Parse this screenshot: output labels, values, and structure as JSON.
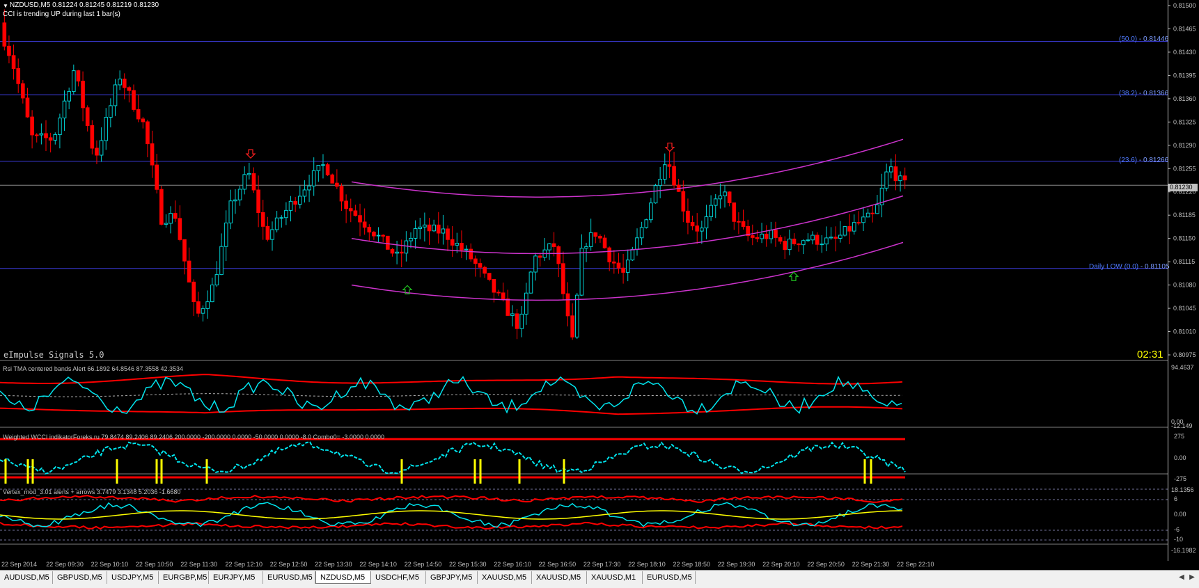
{
  "window": {
    "symbol_header": "NZDUSD,M5  0.81224 0.81245 0.81219 0.81230",
    "trend_message": "CCI is trending UP during last 1 bar(s)",
    "brand": "eImpulse Signals 5.0",
    "timer": "02:31",
    "current_price": "0.81230"
  },
  "price_axis": {
    "labels": [
      "0.81500",
      "0.81465",
      "0.81430",
      "0.81395",
      "0.81360",
      "0.81325",
      "0.81290",
      "0.81255",
      "0.81220",
      "0.81185",
      "0.81150",
      "0.81115",
      "0.81080",
      "0.81045",
      "0.81010",
      "0.80975"
    ],
    "min": 0.80975,
    "max": 0.815
  },
  "fib_levels": [
    {
      "paren": "(50.0)",
      "label": "- 0.81446",
      "value": 0.81446
    },
    {
      "paren": "(38.2)",
      "label": "- 0.81366",
      "value": 0.81366
    },
    {
      "paren": "(23.6)",
      "label": "- 0.81266",
      "value": 0.81266
    },
    {
      "paren": "Daily LOW",
      "paren2": "(0.0)",
      "label": "- 0.81105",
      "value": 0.81105
    }
  ],
  "indicators": {
    "rsi": {
      "title": "Rsi TMA centered bands Alert 66.1892 64.8546 87.3558 42.3534",
      "axis_top": "94.4637",
      "axis_mid": "0.00",
      "axis_bot": "-12.149"
    },
    "wcci": {
      "title": "Weighted WCCI indikatorForeks.ru 79.8474 89.2406 89.2406 200.0000 -200.0000 0.0000 -50.0000 0.0000 -8.0 Combo0= -3.0000 0.0000",
      "axis": [
        "275",
        "0.00",
        "-275"
      ]
    },
    "vertex": {
      "title": "Vertex_mod_3.01 alerts + arrows 3.7479 3.1348 5.2036 -1.6680",
      "axis": [
        "18.1356",
        "6",
        "0.00",
        "-6",
        "-10",
        "-16.1982"
      ]
    }
  },
  "time_axis": [
    "22 Sep 2014",
    "22 Sep 09:30",
    "22 Sep 10:10",
    "22 Sep 10:50",
    "22 Sep 11:30",
    "22 Sep 12:10",
    "22 Sep 12:50",
    "22 Sep 13:30",
    "22 Sep 14:10",
    "22 Sep 14:50",
    "22 Sep 15:30",
    "22 Sep 16:10",
    "22 Sep 16:50",
    "22 Sep 17:30",
    "22 Sep 18:10",
    "22 Sep 18:50",
    "22 Sep 19:30",
    "22 Sep 20:10",
    "22 Sep 20:50",
    "22 Sep 21:30",
    "22 Sep 22:10"
  ],
  "tabs": [
    {
      "label": "AUDUSD,M5",
      "active": false
    },
    {
      "label": "GBPUSD,M5",
      "active": false
    },
    {
      "label": "USDJPY,M5",
      "active": false
    },
    {
      "label": "EURGBP,M5",
      "active": false
    },
    {
      "label": "EURJPY,M5",
      "active": false
    },
    {
      "label": "EURUSD,M5",
      "active": false
    },
    {
      "label": "NZDUSD,M5",
      "active": true
    },
    {
      "label": "USDCHF,M5",
      "active": false
    },
    {
      "label": "GBPJPY,M5",
      "active": false
    },
    {
      "label": "XAUUSD,M5",
      "active": false
    },
    {
      "label": "XAUUSD,M5",
      "active": false
    },
    {
      "label": "XAUUSD,M1",
      "active": false
    },
    {
      "label": "EURUSD,M5",
      "active": false
    }
  ],
  "nav": {
    "left": "◀",
    "right": "▶"
  },
  "colors": {
    "bull": "#00ced1",
    "bear": "#ff0000",
    "fib": "#3c3cdc",
    "band": "#cc33cc",
    "rsi_band": "#ff0000",
    "cyan_line": "#00e5ee",
    "yellow": "#ffff00"
  },
  "chart_data": {
    "type": "candlestick",
    "start_price": 0.81474,
    "end_price": 0.8123,
    "bar_count": 196,
    "signals": [
      {
        "type": "sell-arrow",
        "price": 0.81275
      },
      {
        "type": "buy-arrow",
        "price": 0.81075
      },
      {
        "type": "sell-arrow",
        "price": 0.81285
      },
      {
        "type": "buy-arrow",
        "price": 0.81095
      }
    ]
  }
}
